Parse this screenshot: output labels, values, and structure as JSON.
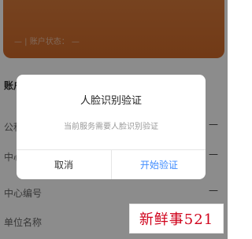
{
  "background": {
    "account_status": "— | 账户状态：  —",
    "section_title": "账户",
    "rows": [
      {
        "label": "公积",
        "value": "—"
      },
      {
        "label": "中心",
        "value": "—"
      },
      {
        "label": "中心编号",
        "value": "—"
      },
      {
        "label": "单位名称",
        "value": ""
      }
    ]
  },
  "dialog": {
    "title": "人脸识别验证",
    "message": "当前服务需要人脸识别验证",
    "cancel_label": "取消",
    "confirm_label": "开始验证"
  },
  "watermark": {
    "text": "新鲜事521"
  },
  "colors": {
    "accent_orange": "#cf6a2a",
    "confirm_blue": "#3f8cff",
    "watermark_red": "#d0021b"
  }
}
